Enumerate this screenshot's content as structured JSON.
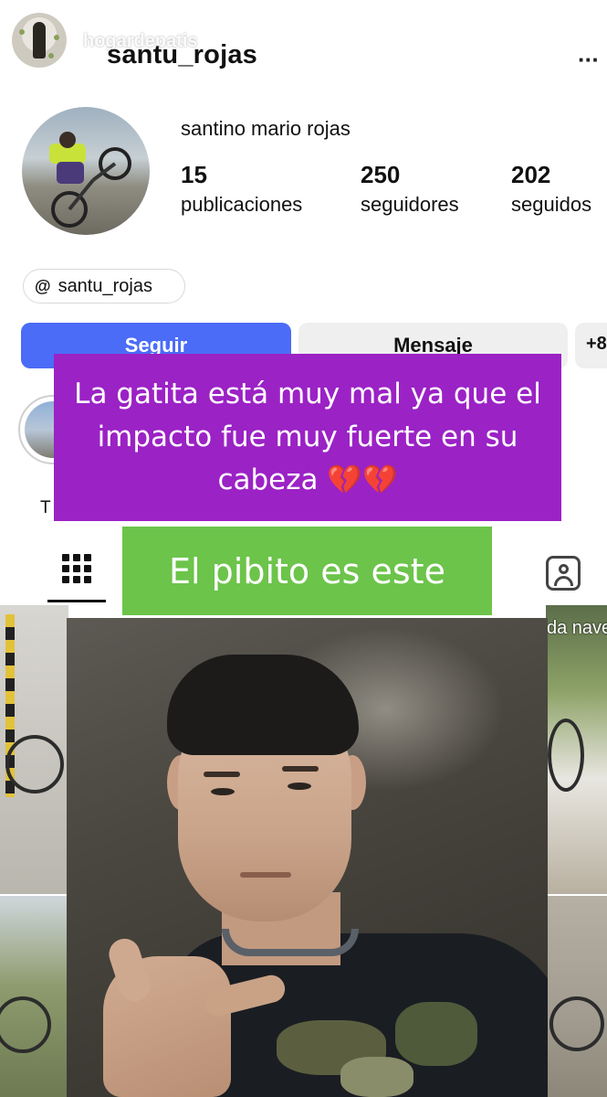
{
  "story": {
    "author_username": "hogardepatis"
  },
  "profile": {
    "username": "santu_rojas",
    "more_icon": "···",
    "full_name": "santino mario rojas",
    "stats": {
      "posts_count": "15",
      "posts_label": "publicaciones",
      "followers_count": "250",
      "followers_label": "seguidores",
      "following_count": "202",
      "following_label": "seguidos"
    },
    "threads": {
      "icon": "@",
      "handle": "santu_rojas"
    },
    "buttons": {
      "follow": "Seguir",
      "message": "Mensaje",
      "add_user_icon": "+8"
    },
    "highlight": {
      "label": "T"
    }
  },
  "grid": {
    "caption_partial": "da nave"
  },
  "overlays": {
    "purple_text": "La gatita está muy mal ya que el impacto fue muy fuerte en su cabeza",
    "purple_emoji": "💔💔",
    "green_text": "El pibito es este"
  },
  "colors": {
    "follow_button": "#4a6cf7",
    "purple_overlay": "#9b22c5",
    "green_overlay": "#6cc44a"
  },
  "icons": [
    "more-options-icon",
    "threads-icon",
    "add-user-icon",
    "grid-tab-icon",
    "tagged-tab-icon",
    "broken-heart-icon"
  ]
}
